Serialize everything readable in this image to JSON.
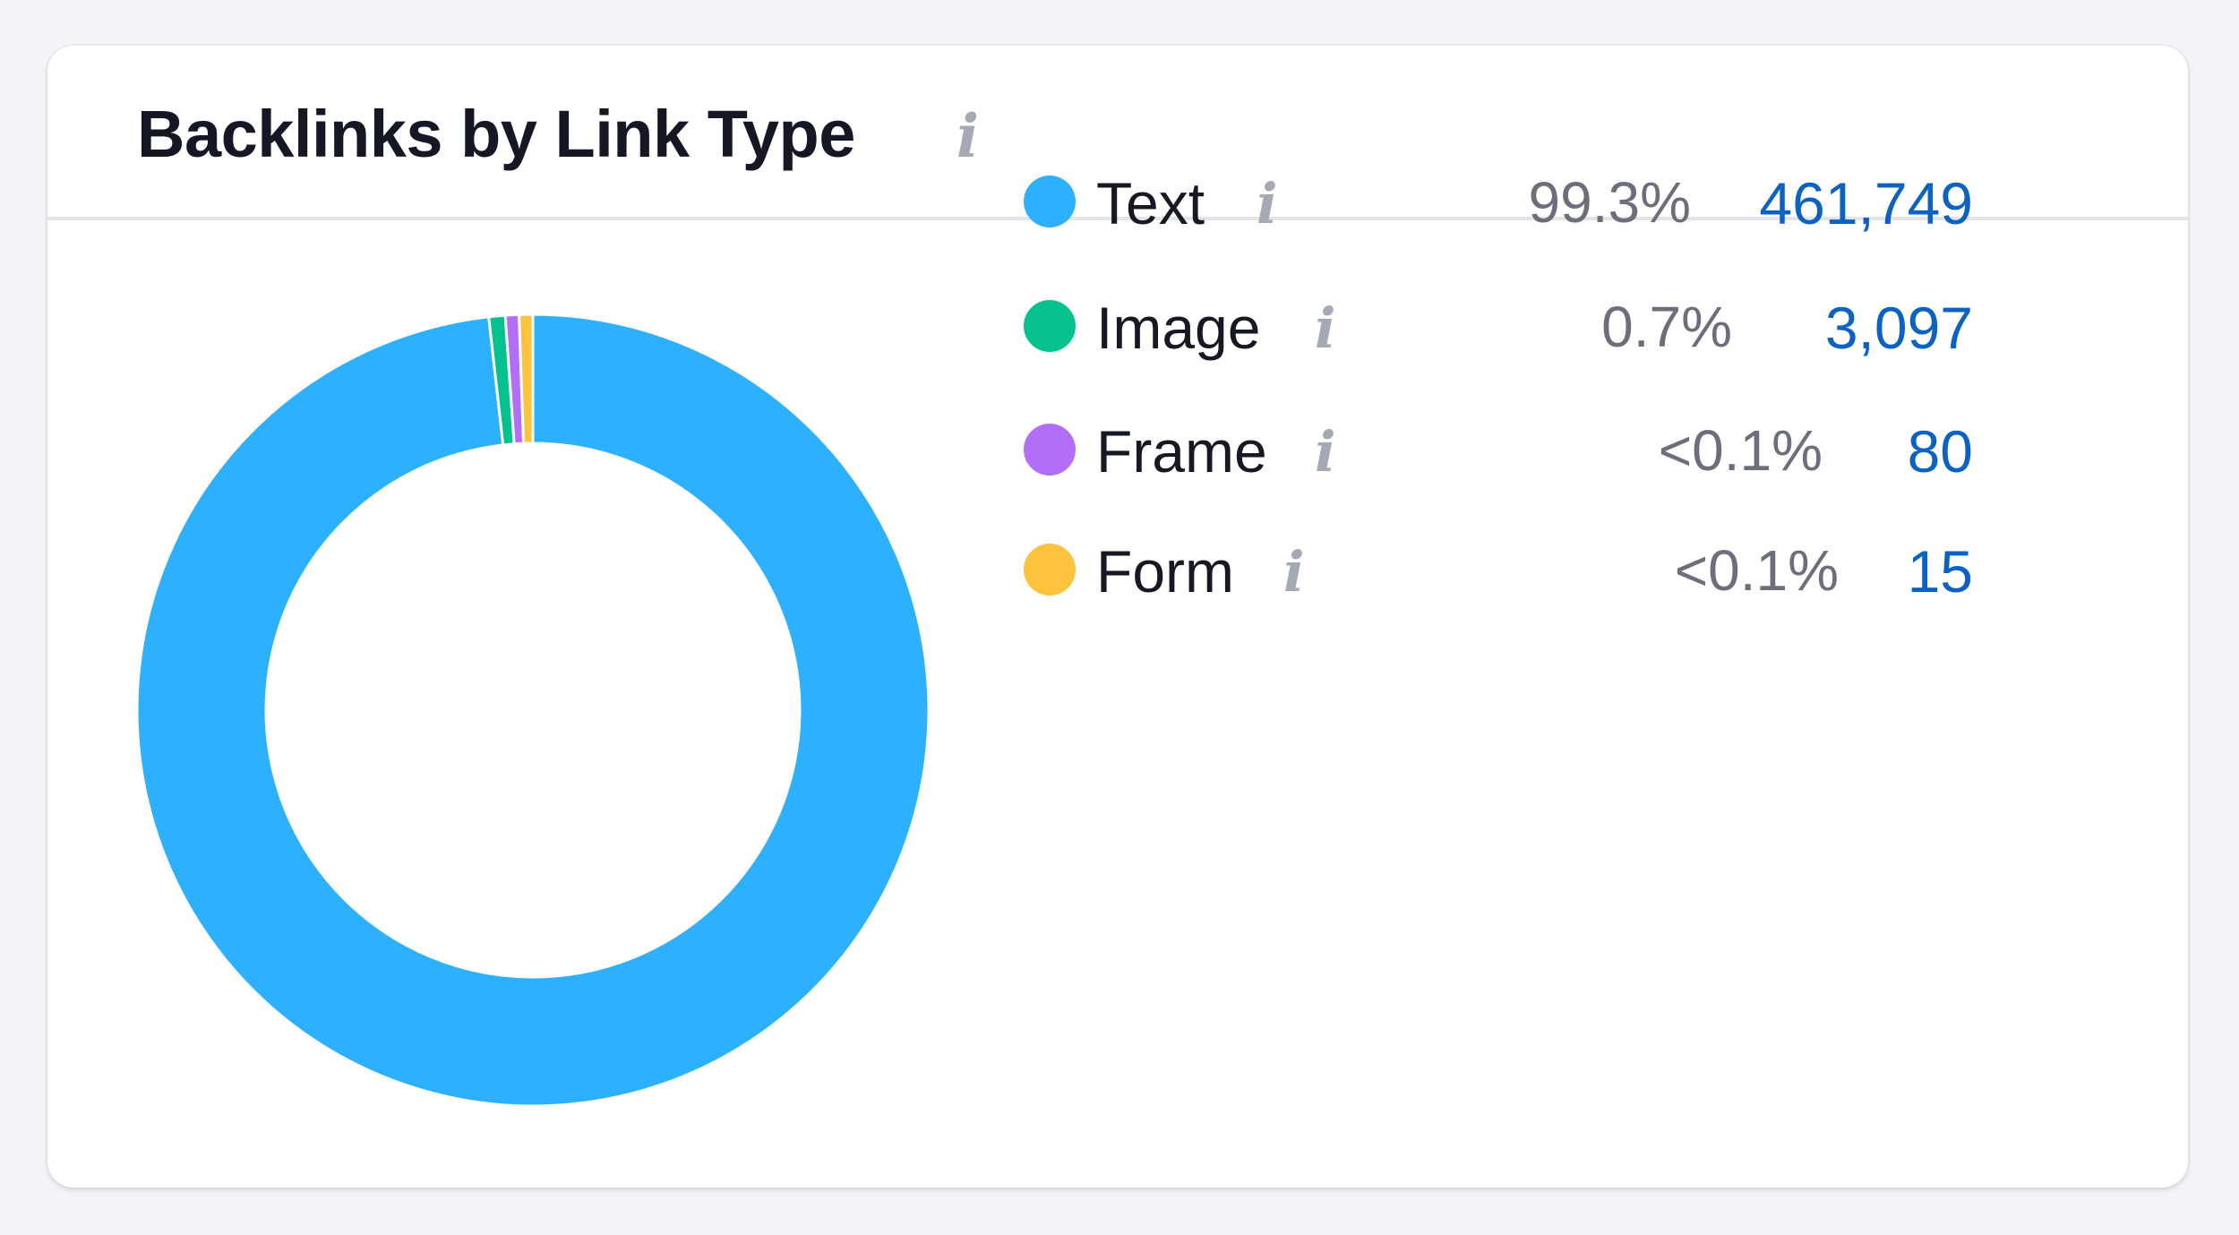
{
  "widget": {
    "title": "Backlinks by Link Type",
    "info_icon": "i"
  },
  "colors": {
    "text": "#2db0fe",
    "image": "#04c18f",
    "frame": "#b26ef9",
    "form": "#ffc23c",
    "count_link": "#0b62c3",
    "percent": "#6c6f7b"
  },
  "legend": [
    {
      "label": "Text",
      "percent": "99.3%",
      "count": "461,749",
      "color": "#2db0fe",
      "icon": "info-icon"
    },
    {
      "label": "Image",
      "percent": "0.7%",
      "count": "3,097",
      "color": "#04c18f",
      "icon": "info-icon"
    },
    {
      "label": "Frame",
      "percent": "<0.1%",
      "count": "80",
      "color": "#b26ef9",
      "icon": "info-icon"
    },
    {
      "label": "Form",
      "percent": "<0.1%",
      "count": "15",
      "color": "#ffc23c",
      "icon": "info-icon"
    }
  ],
  "chart_data": {
    "type": "pie",
    "title": "Backlinks by Link Type",
    "categories": [
      "Text",
      "Image",
      "Frame",
      "Form"
    ],
    "values": [
      461749,
      3097,
      80,
      15
    ],
    "percentages": [
      "99.3%",
      "0.7%",
      "<0.1%",
      "<0.1%"
    ],
    "colors": [
      "#2db0fe",
      "#04c18f",
      "#b26ef9",
      "#ffc23c"
    ],
    "donut": true,
    "legend_placement": "right"
  }
}
